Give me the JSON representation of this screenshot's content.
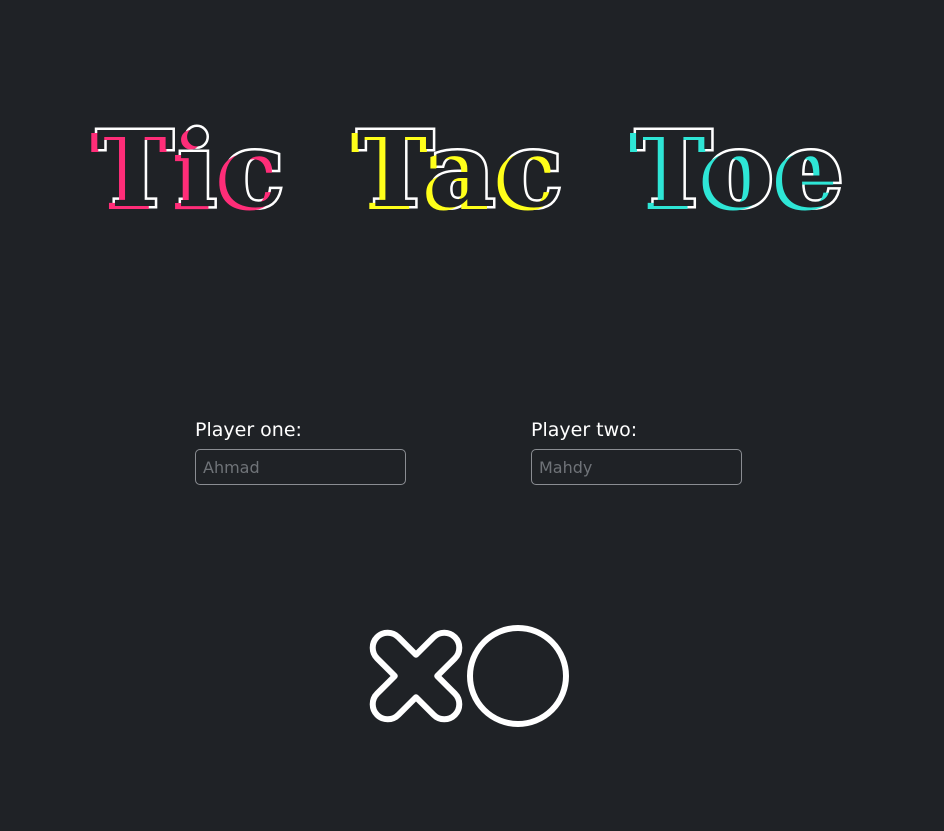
{
  "title": {
    "words": [
      "Tic",
      "Tac",
      "Toe"
    ],
    "colors": [
      "#ff2d78",
      "#ffff1a",
      "#2ee6d6"
    ]
  },
  "players": {
    "one": {
      "label": "Player one:",
      "placeholder": "Ahmad",
      "value": ""
    },
    "two": {
      "label": "Player two:",
      "placeholder": "Mahdy",
      "value": ""
    }
  },
  "play_button": {
    "label": "XO",
    "icon": "xo-logo-icon"
  }
}
